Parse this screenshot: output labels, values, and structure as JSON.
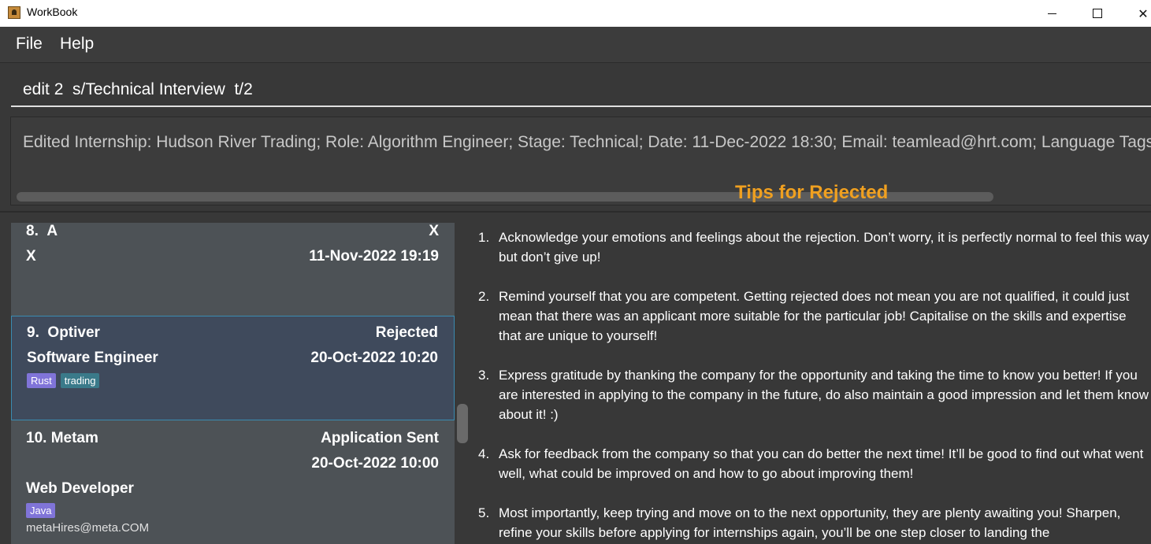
{
  "window": {
    "title": "WorkBook"
  },
  "menu": [
    "File",
    "Help"
  ],
  "command": {
    "value": "edit 2  s/Technical Interview  t/2"
  },
  "result": {
    "text": "Edited Internship: Hudson River Trading; Role: Algorithm Engineer; Stage: Technical; Date: 11-Dec-2022 18:30; Email: teamlead@hrt.com; Language Tags: [Pytho"
  },
  "tips": {
    "title": "Tips for Rejected",
    "items": [
      {
        "num": "1.",
        "text": "Acknowledge your emotions and feelings about the rejection. Don’t worry, it is perfectly normal to feel this way but don’t give up!"
      },
      {
        "num": "2.",
        "text": "Remind yourself that you are competent. Getting rejected does not mean you are not qualified, it could just mean that there was an applicant more suitable for the particular job! Capitalise on the skills and expertise that are unique to yourself!"
      },
      {
        "num": "3.",
        "text": "Express gratitude by thanking the company for the opportunity and taking the time to know you better! If you are interested in applying to the company in the future, do also maintain a good impression and let them know about it! :)"
      },
      {
        "num": "4.",
        "text": "Ask for feedback from the company so that you can do better the next time! It’ll be good to find out what went well, what could be improved on and how to go about improving them!"
      },
      {
        "num": "5.",
        "text": "Most importantly, keep trying and move on to the next opportunity, they are plenty awaiting you! Sharpen, refine your skills before applying for internships again, you’ll be one step closer to landing the"
      }
    ]
  },
  "internships": [
    {
      "index": "8.",
      "company": "A",
      "stage": "X",
      "role": "X",
      "date": "11-Nov-2022 19:19"
    },
    {
      "index": "9.",
      "company": "Optiver",
      "stage": "Rejected",
      "role": "Software Engineer",
      "date": "20-Oct-2022 10:20",
      "lang_tags": [
        "Rust"
      ],
      "tags": [
        "trading"
      ]
    },
    {
      "index": "10.",
      "company": "Metam",
      "stage": "Application Sent",
      "date": "20-Oct-2022 10:00",
      "role": "Web Developer",
      "lang_tags": [
        "Java"
      ],
      "email": "metaHires@meta.COM"
    }
  ]
}
